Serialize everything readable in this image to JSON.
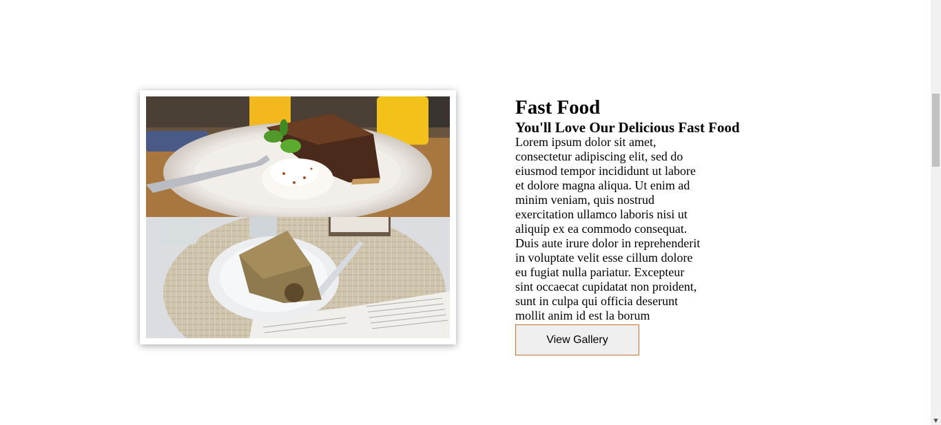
{
  "section": {
    "title": "Fast Food",
    "subtitle": "You'll Love Our Delicious Fast Food",
    "body": "Lorem ipsum dolor sit amet, consectetur adipiscing elit, sed do eiusmod tempor incididunt ut labore et dolore magna aliqua. Ut enim ad minim veniam, quis nostrud exercitation ullamco laboris nisi ut aliquip ex ea commodo consequat. Duis aute irure dolor in reprehenderit in voluptate velit esse cillum dolore eu fugiat nulla pariatur. Excepteur sint occaecat cupidatat non proident, sunt in culpa qui officia deserunt mollit anim id est la borum",
    "button_label": "View Gallery"
  },
  "images": {
    "top": "chocolate-cake-with-cream-photo",
    "bottom": "cake-slice-on-plate-photo"
  },
  "colors": {
    "button_border": "#c9702b",
    "button_bg": "#efefef",
    "scrollbar_thumb": "#c1c1c1"
  }
}
